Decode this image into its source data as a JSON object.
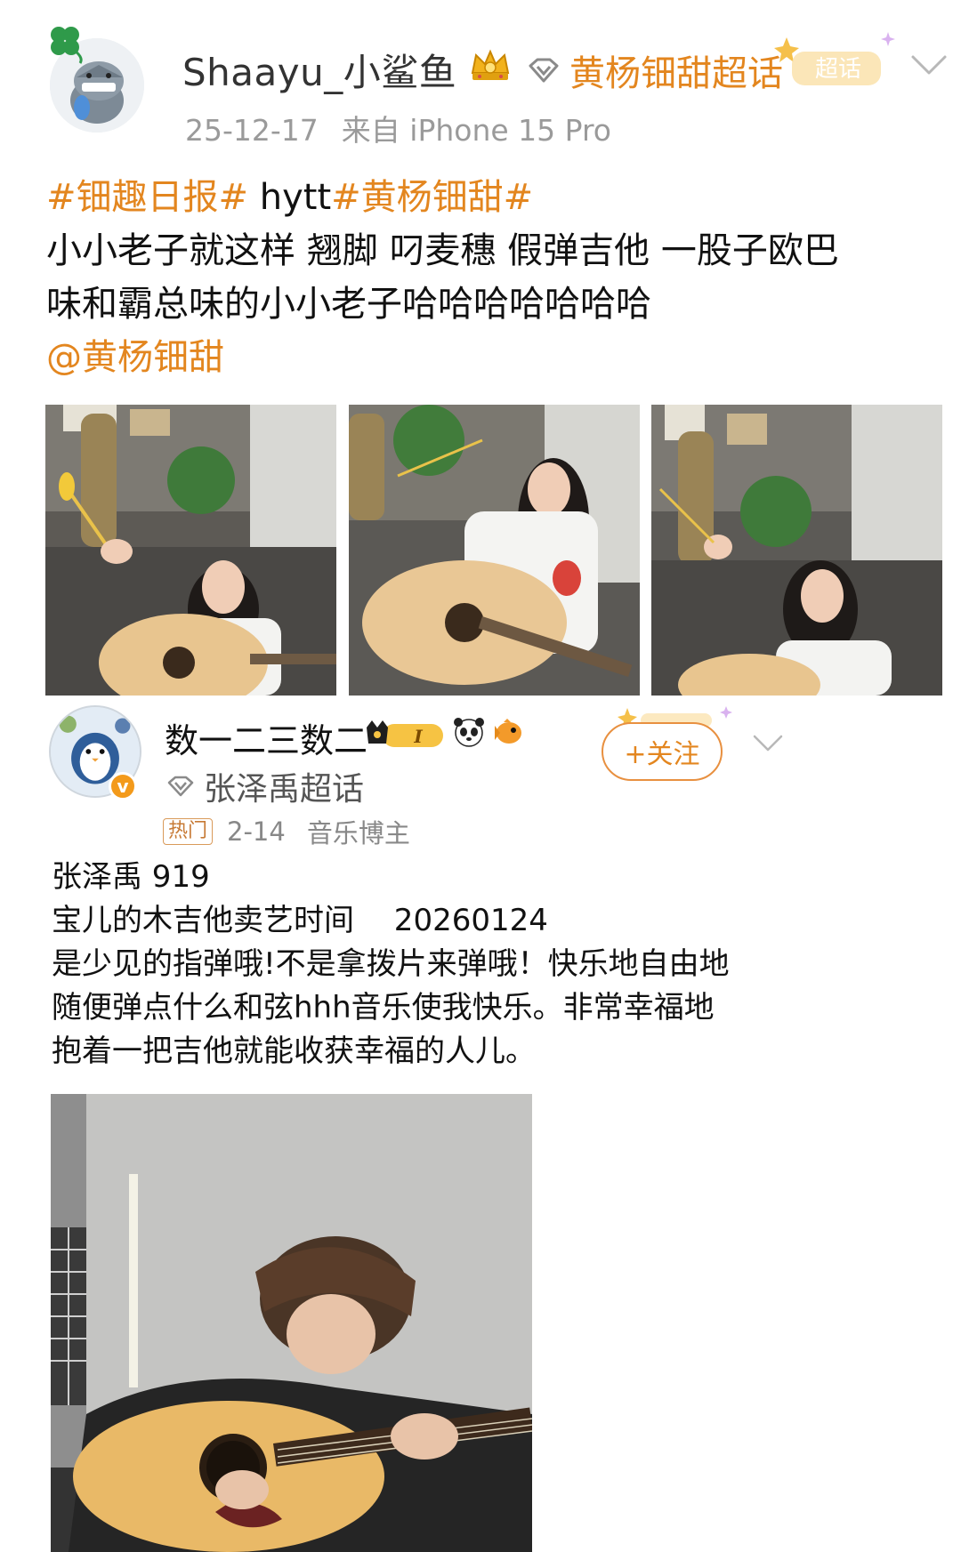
{
  "post1": {
    "username": "Shaayu_小鲨鱼",
    "topic": "黄杨钿甜超话",
    "badge_text": "超话",
    "date": "25-12-17",
    "source": "来自 iPhone 15 Pro",
    "text_lines": [
      [
        {
          "t": "#钿趣日报#",
          "tag": true
        },
        {
          "t": " hytt",
          "tag": false
        },
        {
          "t": "#黄杨钿甜#",
          "tag": true
        }
      ],
      [
        {
          "t": "小小老子就这样 翘脚 叼麦穗 假弹吉他 一股子欧巴",
          "tag": false
        }
      ],
      [
        {
          "t": "味和霸总味的小小老子哈哈哈哈哈哈哈",
          "tag": false
        }
      ],
      [
        {
          "t": "@黄杨钿甜",
          "tag": true
        }
      ]
    ],
    "photos": [
      "girl-with-guitar-photo-1",
      "girl-with-guitar-photo-2",
      "girl-with-guitar-photo-3"
    ]
  },
  "post2": {
    "username": "数一二三数二",
    "level_badge": "I",
    "topic": "张泽禹超话",
    "follow_label": "+关注",
    "hot_tag": "热门",
    "date": "2-14",
    "category": "音乐博主",
    "text_lines": [
      "张泽禹 919",
      "宝儿的木吉他卖艺时间　 20260124",
      "是少见的指弹哦!不是拿拨片来弹哦！快乐地自由地",
      "随便弹点什么和弦hhh音乐使我快乐。非常幸福地",
      "抱着一把吉他就能收获幸福的人儿。"
    ],
    "verified_mark": "v"
  },
  "colors": {
    "accent": "#e3861f",
    "text": "#111111",
    "meta": "#9a9a9a"
  }
}
